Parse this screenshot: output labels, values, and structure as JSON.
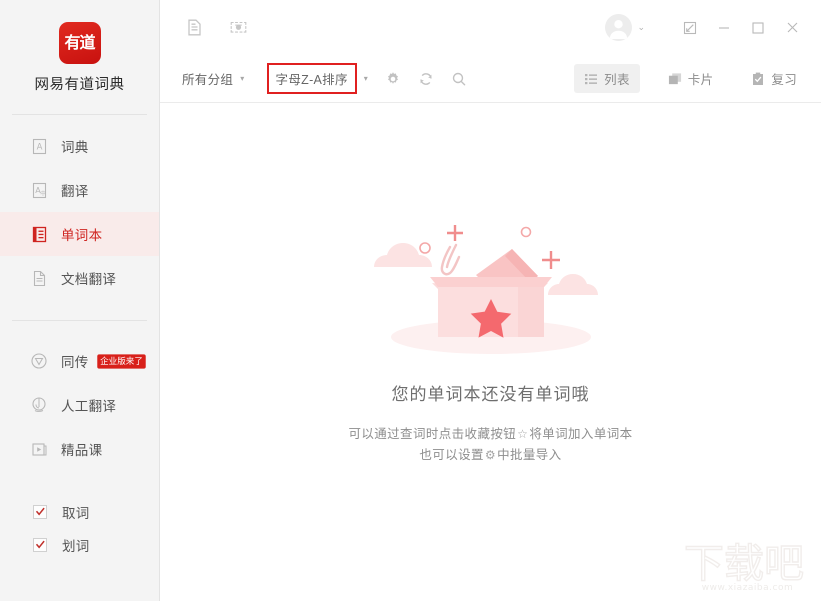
{
  "app": {
    "brand_name": "网易有道词典",
    "logo_glyph": "有道",
    "accent_color": "#cf2420",
    "brand_red": "#d8201a",
    "highlight_color": "#e02020"
  },
  "sidebar": {
    "nav_primary": [
      {
        "label": "词典",
        "icon": "dictionary-icon",
        "active": false
      },
      {
        "label": "翻译",
        "icon": "translate-icon",
        "active": false
      },
      {
        "label": "单词本",
        "icon": "wordbook-icon",
        "active": true
      },
      {
        "label": "文档翻译",
        "icon": "document-translate-icon",
        "active": false
      }
    ],
    "nav_secondary": [
      {
        "label": "同传",
        "icon": "simultaneous-interpretation-icon",
        "badge": "企业版来了"
      },
      {
        "label": "人工翻译",
        "icon": "human-translation-icon",
        "badge": ""
      },
      {
        "label": "精品课",
        "icon": "course-icon",
        "badge": ""
      }
    ],
    "checkboxes": [
      {
        "label": "取词",
        "checked": true,
        "mark": "✓"
      },
      {
        "label": "划词",
        "checked": true,
        "mark": "✓"
      }
    ]
  },
  "titlebar": {
    "left_icons": [
      {
        "name": "document-icon"
      },
      {
        "name": "screenshot-icon"
      }
    ],
    "avatar_caret": "⌄",
    "window_controls": [
      {
        "name": "mini-mode-button",
        "glyph": "mini"
      },
      {
        "name": "minimize-button",
        "glyph": "minimize"
      },
      {
        "name": "maximize-button",
        "glyph": "maximize"
      },
      {
        "name": "close-button",
        "glyph": "close"
      }
    ]
  },
  "toolbar": {
    "group_filter": {
      "label": "所有分组",
      "caret": "▾"
    },
    "sort_filter": {
      "label": "字母Z-A排序",
      "caret": "▾",
      "highlighted": true
    },
    "icons": [
      {
        "name": "gear-icon"
      },
      {
        "name": "refresh-icon"
      },
      {
        "name": "search-icon"
      }
    ],
    "view_tabs": [
      {
        "label": "列表",
        "icon": "list-icon",
        "active": true
      },
      {
        "label": "卡片",
        "icon": "cards-icon",
        "active": false
      },
      {
        "label": "复习",
        "icon": "review-icon",
        "active": false
      }
    ]
  },
  "empty_state": {
    "title": "您的单词本还没有单词哦",
    "line1_before": "可以通过查词时点击收藏按钮",
    "line1_glyph": "☆",
    "line1_after": "将单词加入单词本",
    "line2_before": "也可以设置",
    "line2_glyph": "⚙",
    "line2_after": "中批量导入"
  },
  "watermark": {
    "logo_text": "下载吧",
    "url": "www.xiazaiba.com"
  }
}
